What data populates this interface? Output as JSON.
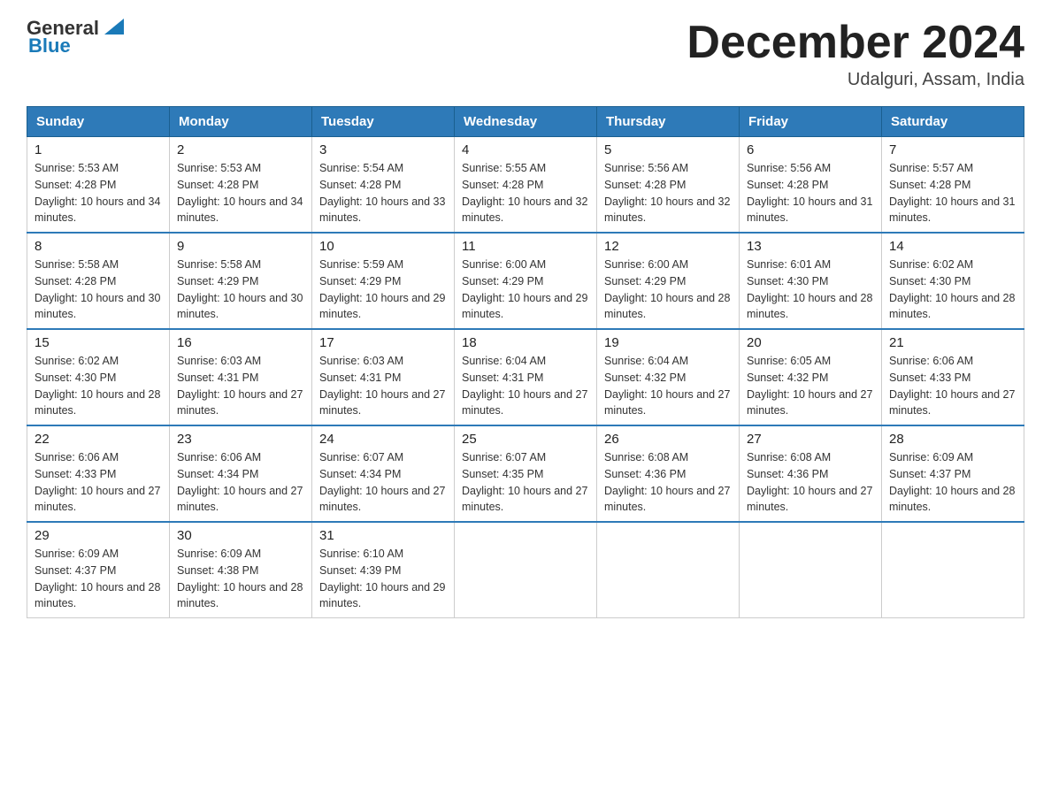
{
  "header": {
    "logo_text_general": "General",
    "logo_text_blue": "Blue",
    "month_title": "December 2024",
    "location": "Udalguri, Assam, India"
  },
  "weekdays": [
    "Sunday",
    "Monday",
    "Tuesday",
    "Wednesday",
    "Thursday",
    "Friday",
    "Saturday"
  ],
  "weeks": [
    [
      {
        "day": "1",
        "sunrise": "5:53 AM",
        "sunset": "4:28 PM",
        "daylight": "10 hours and 34 minutes."
      },
      {
        "day": "2",
        "sunrise": "5:53 AM",
        "sunset": "4:28 PM",
        "daylight": "10 hours and 34 minutes."
      },
      {
        "day": "3",
        "sunrise": "5:54 AM",
        "sunset": "4:28 PM",
        "daylight": "10 hours and 33 minutes."
      },
      {
        "day": "4",
        "sunrise": "5:55 AM",
        "sunset": "4:28 PM",
        "daylight": "10 hours and 32 minutes."
      },
      {
        "day": "5",
        "sunrise": "5:56 AM",
        "sunset": "4:28 PM",
        "daylight": "10 hours and 32 minutes."
      },
      {
        "day": "6",
        "sunrise": "5:56 AM",
        "sunset": "4:28 PM",
        "daylight": "10 hours and 31 minutes."
      },
      {
        "day": "7",
        "sunrise": "5:57 AM",
        "sunset": "4:28 PM",
        "daylight": "10 hours and 31 minutes."
      }
    ],
    [
      {
        "day": "8",
        "sunrise": "5:58 AM",
        "sunset": "4:28 PM",
        "daylight": "10 hours and 30 minutes."
      },
      {
        "day": "9",
        "sunrise": "5:58 AM",
        "sunset": "4:29 PM",
        "daylight": "10 hours and 30 minutes."
      },
      {
        "day": "10",
        "sunrise": "5:59 AM",
        "sunset": "4:29 PM",
        "daylight": "10 hours and 29 minutes."
      },
      {
        "day": "11",
        "sunrise": "6:00 AM",
        "sunset": "4:29 PM",
        "daylight": "10 hours and 29 minutes."
      },
      {
        "day": "12",
        "sunrise": "6:00 AM",
        "sunset": "4:29 PM",
        "daylight": "10 hours and 28 minutes."
      },
      {
        "day": "13",
        "sunrise": "6:01 AM",
        "sunset": "4:30 PM",
        "daylight": "10 hours and 28 minutes."
      },
      {
        "day": "14",
        "sunrise": "6:02 AM",
        "sunset": "4:30 PM",
        "daylight": "10 hours and 28 minutes."
      }
    ],
    [
      {
        "day": "15",
        "sunrise": "6:02 AM",
        "sunset": "4:30 PM",
        "daylight": "10 hours and 28 minutes."
      },
      {
        "day": "16",
        "sunrise": "6:03 AM",
        "sunset": "4:31 PM",
        "daylight": "10 hours and 27 minutes."
      },
      {
        "day": "17",
        "sunrise": "6:03 AM",
        "sunset": "4:31 PM",
        "daylight": "10 hours and 27 minutes."
      },
      {
        "day": "18",
        "sunrise": "6:04 AM",
        "sunset": "4:31 PM",
        "daylight": "10 hours and 27 minutes."
      },
      {
        "day": "19",
        "sunrise": "6:04 AM",
        "sunset": "4:32 PM",
        "daylight": "10 hours and 27 minutes."
      },
      {
        "day": "20",
        "sunrise": "6:05 AM",
        "sunset": "4:32 PM",
        "daylight": "10 hours and 27 minutes."
      },
      {
        "day": "21",
        "sunrise": "6:06 AM",
        "sunset": "4:33 PM",
        "daylight": "10 hours and 27 minutes."
      }
    ],
    [
      {
        "day": "22",
        "sunrise": "6:06 AM",
        "sunset": "4:33 PM",
        "daylight": "10 hours and 27 minutes."
      },
      {
        "day": "23",
        "sunrise": "6:06 AM",
        "sunset": "4:34 PM",
        "daylight": "10 hours and 27 minutes."
      },
      {
        "day": "24",
        "sunrise": "6:07 AM",
        "sunset": "4:34 PM",
        "daylight": "10 hours and 27 minutes."
      },
      {
        "day": "25",
        "sunrise": "6:07 AM",
        "sunset": "4:35 PM",
        "daylight": "10 hours and 27 minutes."
      },
      {
        "day": "26",
        "sunrise": "6:08 AM",
        "sunset": "4:36 PM",
        "daylight": "10 hours and 27 minutes."
      },
      {
        "day": "27",
        "sunrise": "6:08 AM",
        "sunset": "4:36 PM",
        "daylight": "10 hours and 27 minutes."
      },
      {
        "day": "28",
        "sunrise": "6:09 AM",
        "sunset": "4:37 PM",
        "daylight": "10 hours and 28 minutes."
      }
    ],
    [
      {
        "day": "29",
        "sunrise": "6:09 AM",
        "sunset": "4:37 PM",
        "daylight": "10 hours and 28 minutes."
      },
      {
        "day": "30",
        "sunrise": "6:09 AM",
        "sunset": "4:38 PM",
        "daylight": "10 hours and 28 minutes."
      },
      {
        "day": "31",
        "sunrise": "6:10 AM",
        "sunset": "4:39 PM",
        "daylight": "10 hours and 29 minutes."
      },
      null,
      null,
      null,
      null
    ]
  ]
}
